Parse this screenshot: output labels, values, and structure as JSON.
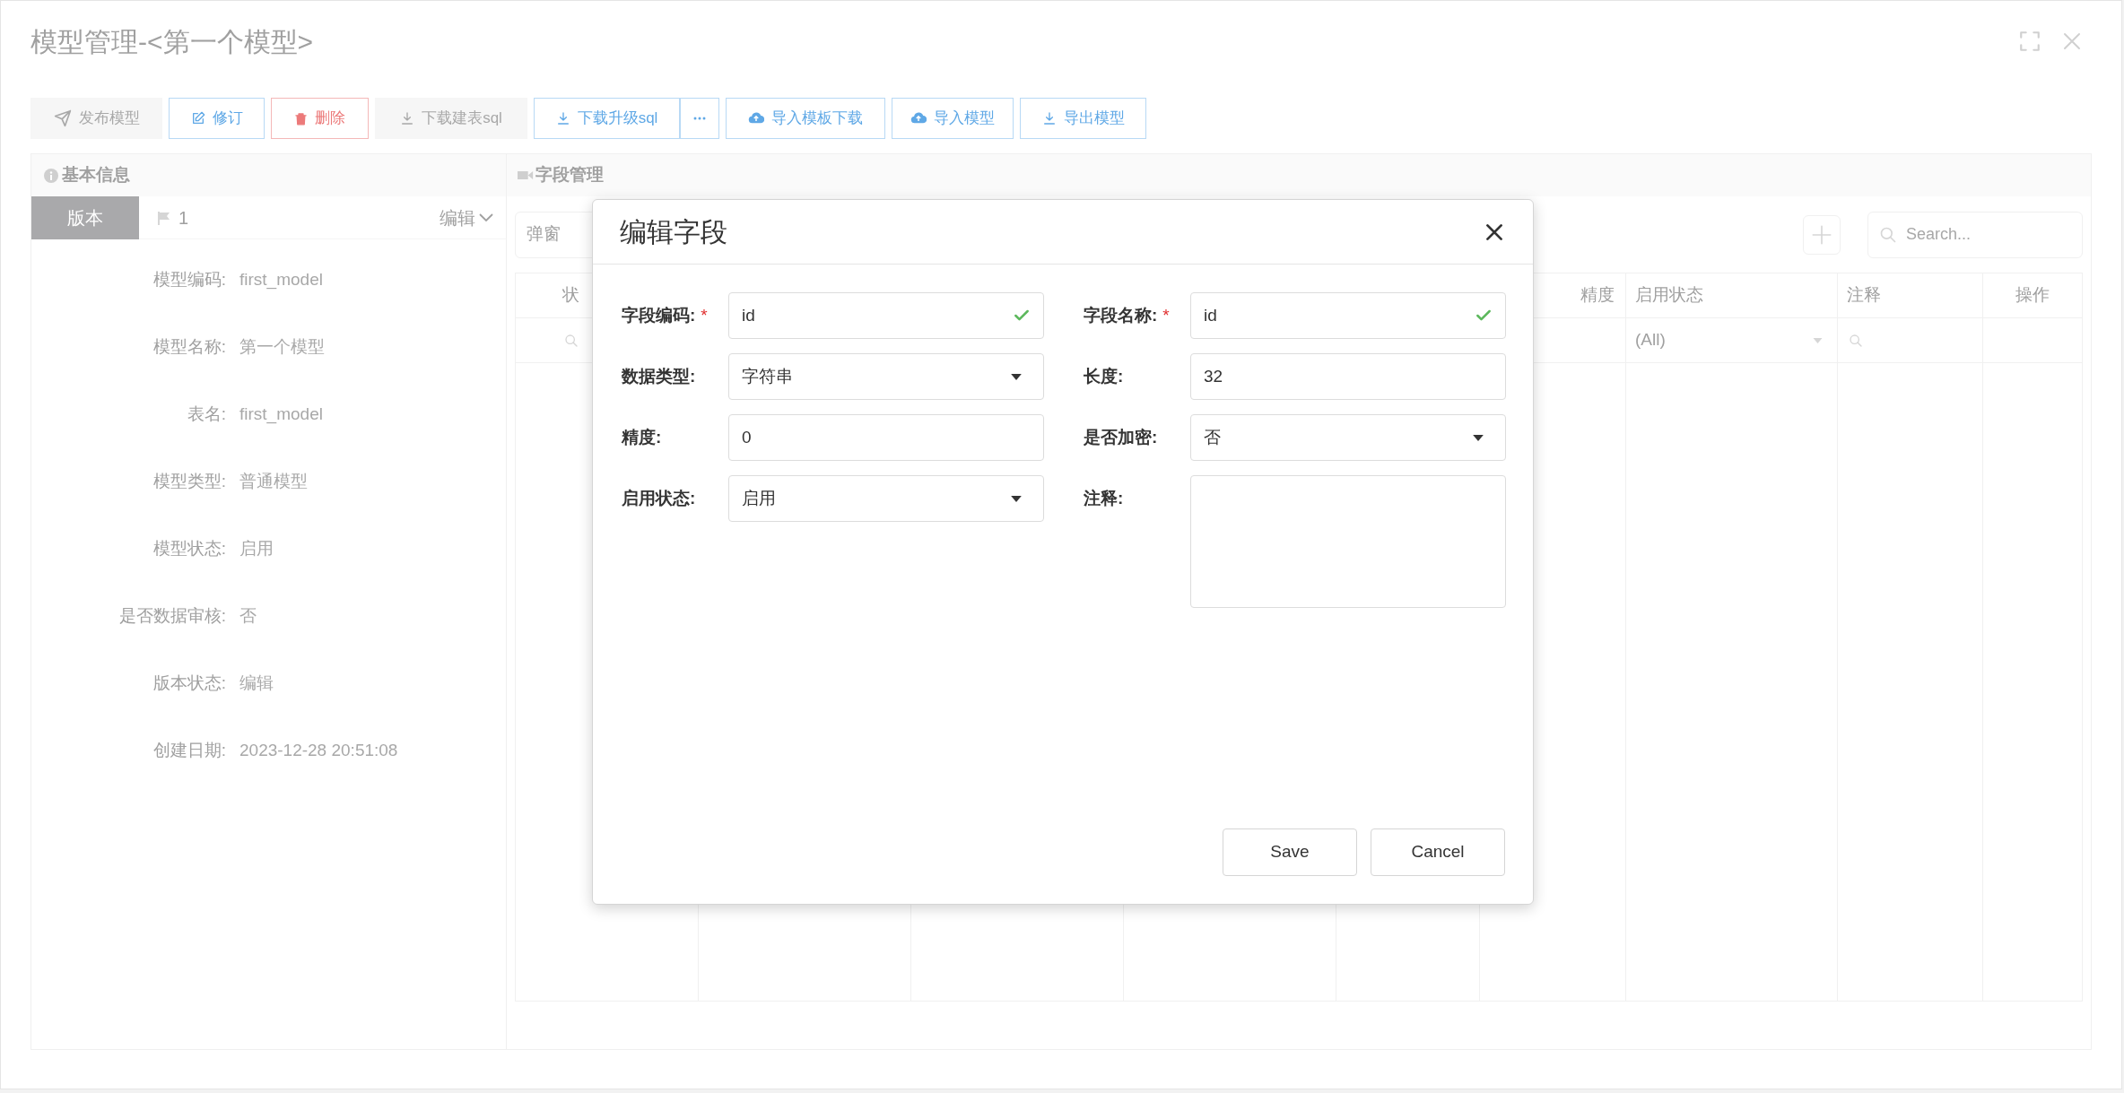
{
  "window": {
    "title": "模型管理-<第一个模型>"
  },
  "toolbar": [
    {
      "label": "发布模型",
      "kind": "default",
      "disabled": true
    },
    {
      "label": "修订",
      "kind": "primary",
      "disabled": false
    },
    {
      "label": "删除",
      "kind": "danger",
      "disabled": false
    },
    {
      "label": "下载建表sql",
      "kind": "default",
      "disabled": true
    },
    {
      "label": "下载升级sql",
      "kind": "primary",
      "disabled": false
    },
    {
      "label": "导入模板下载",
      "kind": "primary",
      "disabled": false
    },
    {
      "label": "导入模型",
      "kind": "primary",
      "disabled": false
    },
    {
      "label": "导出模型",
      "kind": "primary",
      "disabled": false
    }
  ],
  "basic_info": {
    "title": "基本信息",
    "version_tab": "版本",
    "version": "1",
    "edit_menu": "编辑",
    "fields": [
      {
        "label": "模型编码:",
        "value": "first_model"
      },
      {
        "label": "模型名称:",
        "value": "第一个模型"
      },
      {
        "label": "表名:",
        "value": "first_model"
      },
      {
        "label": "模型类型:",
        "value": "普通模型"
      },
      {
        "label": "模型状态:",
        "value": "启用"
      },
      {
        "label": "是否数据审核:",
        "value": "否"
      },
      {
        "label": "版本状态:",
        "value": "编辑"
      },
      {
        "label": "创建日期:",
        "value": "2023-12-28 20:51:08"
      }
    ]
  },
  "fields_panel": {
    "title": "字段管理",
    "popup_field": "弹窗",
    "search": {
      "placeholder": "Search..."
    },
    "table": {
      "columns": [
        "状",
        "精度",
        "启用状态",
        "注释",
        "操作"
      ],
      "status_filter": "(All)"
    }
  },
  "dialog": {
    "title": "编辑字段",
    "fields": [
      {
        "label": "字段编码:",
        "value": "id",
        "kind": "text",
        "required": true,
        "valid": true
      },
      {
        "label": "字段名称:",
        "value": "id",
        "kind": "text",
        "required": true,
        "valid": true
      },
      {
        "label": "数据类型:",
        "value": "字符串",
        "kind": "select",
        "required": false,
        "valid": false
      },
      {
        "label": "长度:",
        "value": "32",
        "kind": "text",
        "required": false,
        "valid": false
      },
      {
        "label": "精度:",
        "value": "0",
        "kind": "text",
        "required": false,
        "valid": false
      },
      {
        "label": "是否加密:",
        "value": "否",
        "kind": "select",
        "required": false,
        "valid": false
      },
      {
        "label": "启用状态:",
        "value": "启用",
        "kind": "select",
        "required": false,
        "valid": false
      },
      {
        "label": "注释:",
        "kind": "textarea",
        "required": false,
        "valid": false
      }
    ],
    "required_mark": "*",
    "buttons": [
      "Save",
      "Cancel"
    ]
  }
}
